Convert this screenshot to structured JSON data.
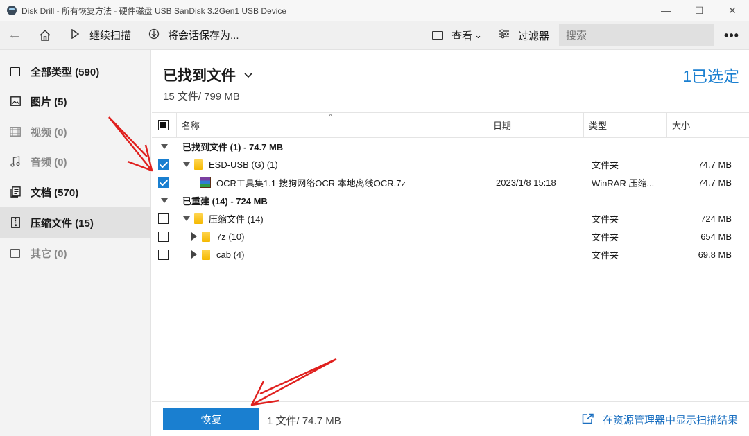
{
  "window": {
    "title": "Disk Drill - 所有恢复方法 - 硬件磁盘 USB  SanDisk 3.2Gen1 USB Device",
    "minimize": "—",
    "maximize": "☐",
    "close": "✕"
  },
  "toolbar": {
    "back_icon": "←",
    "home_icon": "⌂",
    "continue_scan": "继续扫描",
    "save_session": "将会话保存为...",
    "view": "查看",
    "view_chevron": "⌄",
    "filter": "过滤器",
    "search_placeholder": "搜索",
    "more": "•••"
  },
  "sidebar": {
    "items": [
      {
        "label": "全部类型 (590)",
        "icon": "all-types-icon"
      },
      {
        "label": "图片 (5)",
        "icon": "image-icon"
      },
      {
        "label": "视频 (0)",
        "icon": "video-icon"
      },
      {
        "label": "音频 (0)",
        "icon": "audio-icon"
      },
      {
        "label": "文档 (570)",
        "icon": "document-icon"
      },
      {
        "label": "压缩文件 (15)",
        "icon": "archive-icon"
      },
      {
        "label": "其它 (0)",
        "icon": "other-icon"
      }
    ]
  },
  "main": {
    "title": "已找到文件",
    "subtitle": "15 文件/ 799 MB",
    "selected": "1已选定"
  },
  "table": {
    "headers": {
      "name": "名称",
      "date": "日期",
      "type": "类型",
      "size": "大小"
    },
    "sort_indicator": "^",
    "groups": [
      {
        "label": "已找到文件 (1) - 74.7 MB",
        "rows": [
          {
            "name": "ESD-USB (G) (1)",
            "date": "",
            "type": "文件夹",
            "size": "74.7 MB"
          },
          {
            "name": "OCR工具集1.1-搜狗网络OCR 本地离线OCR.7z",
            "date": "2023/1/8 15:18",
            "type": "WinRAR 压缩...",
            "size": "74.7 MB"
          }
        ]
      },
      {
        "label": "已重建 (14) - 724 MB",
        "rows": [
          {
            "name": "压缩文件 (14)",
            "date": "",
            "type": "文件夹",
            "size": "724 MB"
          },
          {
            "name": "7z (10)",
            "date": "",
            "type": "文件夹",
            "size": "654 MB"
          },
          {
            "name": "cab (4)",
            "date": "",
            "type": "文件夹",
            "size": "69.8 MB"
          }
        ]
      }
    ]
  },
  "bottom": {
    "recover_button": "恢复",
    "info": "1 文件/ 74.7 MB",
    "explorer_link": "在资源管理器中显示扫描结果"
  },
  "colors": {
    "accent": "#1a7fd0",
    "annotation_arrow": "#e0201e"
  }
}
